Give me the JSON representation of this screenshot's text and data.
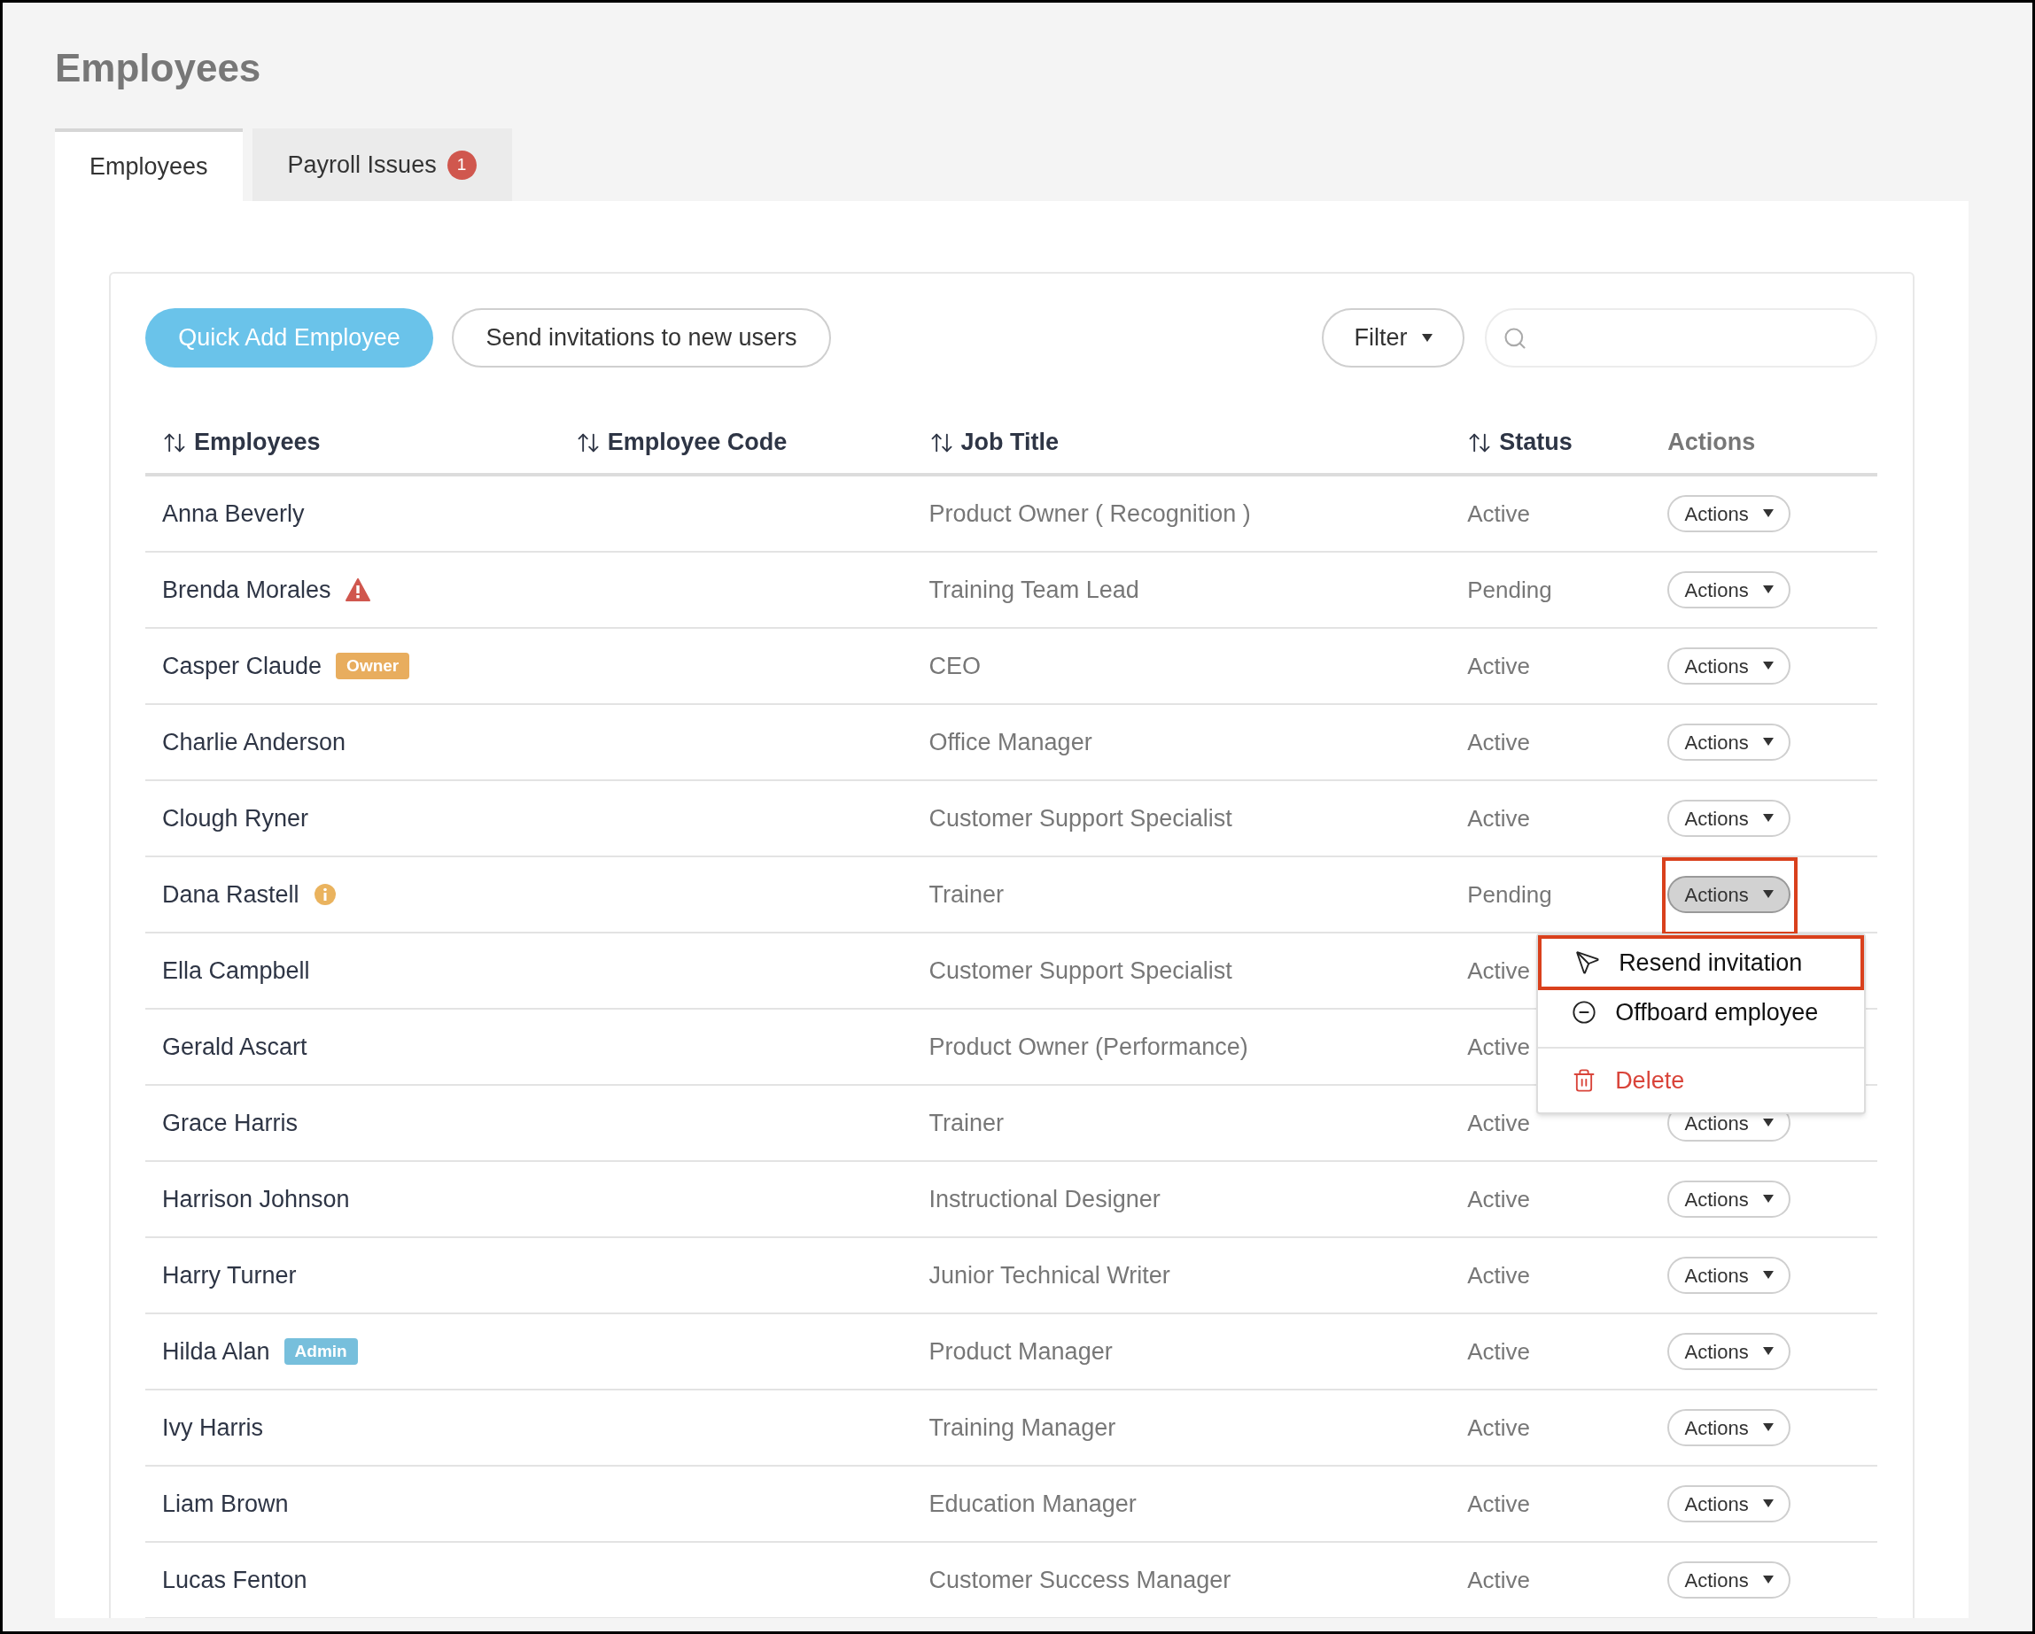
{
  "title": "Employees",
  "tabs": [
    {
      "label": "Employees",
      "selected": true
    },
    {
      "label": "Payroll Issues",
      "selected": false,
      "badge": "1"
    }
  ],
  "toolbar": {
    "primary_button": "Quick Add Employee",
    "secondary_button": "Send invitations to new users",
    "filter_button": "Filter"
  },
  "columns": [
    {
      "label": "Employees",
      "sortable": true
    },
    {
      "label": "Employee Code",
      "sortable": true
    },
    {
      "label": "Job Title",
      "sortable": true
    },
    {
      "label": "Status",
      "sortable": true
    },
    {
      "label": "Actions",
      "sortable": false
    }
  ],
  "rows": [
    {
      "name": "Anna Beverly",
      "job_title": "Product Owner ( Recognition )",
      "status": "Active",
      "action_button": "Actions",
      "open": false
    },
    {
      "name": "Brenda Morales",
      "warning": true,
      "job_title": "Training Team Lead",
      "status": "Pending",
      "action_button": "Actions",
      "open": false
    },
    {
      "name": "Casper Claude",
      "tag": {
        "text": "Owner",
        "color": "#e8ad5e"
      },
      "job_title": "CEO",
      "status": "Active",
      "action_button": "Actions",
      "open": false
    },
    {
      "name": "Charlie Anderson",
      "job_title": "Office Manager",
      "status": "Active",
      "action_button": "Actions",
      "open": false
    },
    {
      "name": "Clough Ryner",
      "job_title": "Customer Support Specialist",
      "status": "Active",
      "action_button": "Actions",
      "open": false
    },
    {
      "name": "Dana Rastell",
      "info": true,
      "job_title": "Trainer",
      "status": "Pending",
      "action_button": "Actions",
      "open": true,
      "annotated": true
    },
    {
      "name": "Ella Campbell",
      "job_title": "Customer Support Specialist",
      "status": "Active"
    },
    {
      "name": "Gerald Ascart",
      "job_title": "Product Owner (Performance)",
      "status": "Active"
    },
    {
      "name": "Grace Harris",
      "job_title": "Trainer",
      "status": "Active",
      "action_button": "Actions",
      "open": false
    },
    {
      "name": "Harrison Johnson",
      "job_title": "Instructional Designer",
      "status": "Active",
      "action_button": "Actions",
      "open": false
    },
    {
      "name": "Harry Turner",
      "job_title": "Junior Technical Writer",
      "status": "Active",
      "action_button": "Actions",
      "open": false
    },
    {
      "name": "Hilda Alan",
      "tag": {
        "text": "Admin",
        "color": "#77bfdc"
      },
      "job_title": "Product Manager",
      "status": "Active",
      "action_button": "Actions",
      "open": false
    },
    {
      "name": "Ivy Harris",
      "job_title": "Training Manager",
      "status": "Active",
      "action_button": "Actions",
      "open": false
    },
    {
      "name": "Liam Brown",
      "job_title": "Education Manager",
      "status": "Active",
      "action_button": "Actions",
      "open": false
    },
    {
      "name": "Lucas Fenton",
      "job_title": "Customer Success Manager",
      "status": "Active",
      "action_button": "Actions",
      "open": false
    }
  ],
  "action_menu": {
    "items": [
      {
        "kind": "send",
        "label": "Resend invitation",
        "annotated": true
      },
      {
        "kind": "offboard",
        "label": "Offboard employee",
        "annotated": false
      },
      {
        "kind": "delete",
        "label": "Delete",
        "annotated": false
      }
    ]
  }
}
